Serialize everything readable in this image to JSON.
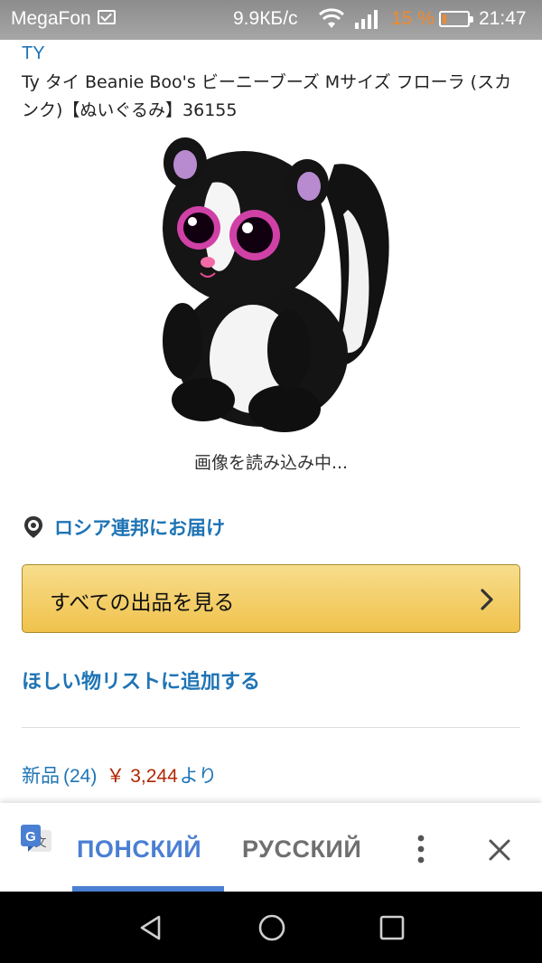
{
  "status_bar": {
    "carrier": "MegaFon",
    "net_speed": "9.9КБ/с",
    "battery_percent": "15 %",
    "battery_level": 0.15,
    "time": "21:47",
    "accent_color": "#f08a2a"
  },
  "product": {
    "brand": "TY",
    "title": "Ty タイ Beanie Boo's ビーニーブーズ Mサイズ フローラ (スカンク)【ぬいぐるみ】36155",
    "image_loading_text": "画像を読み込み中..."
  },
  "delivery": {
    "icon": "location-pin-icon",
    "text": "ロシア連邦にお届け"
  },
  "see_all_button": {
    "label": "すべての出品を見る",
    "icon": "chevron-right-icon"
  },
  "wishlist": {
    "label": "ほしい物リストに追加する"
  },
  "offers": {
    "label": "新品",
    "count": "(24)",
    "price": "￥ 3,244",
    "suffix": "より"
  },
  "translate_bar": {
    "source_language": "ПОНСКИЙ",
    "target_language": "РУССКИЙ",
    "icons": [
      "google-translate-icon",
      "more-vertical-icon",
      "close-icon"
    ]
  },
  "nav_bar": {
    "icons": [
      "back-icon",
      "home-icon",
      "recents-icon"
    ]
  },
  "colors": {
    "link": "#1f74b5",
    "price": "#b12704",
    "button_top": "#f7dd8c",
    "button_bottom": "#f0c24b",
    "translate_accent": "#4a7fd3"
  }
}
